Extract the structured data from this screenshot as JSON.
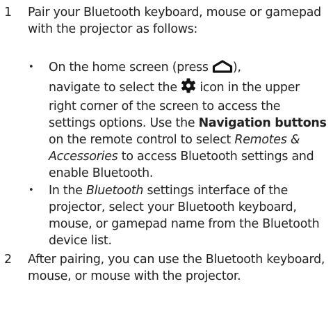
{
  "steps": [
    {
      "number": "1",
      "text": "Pair your Bluetooth keyboard, mouse or gamepad with the projector as follows:"
    },
    {
      "number": "2",
      "text": "After pairing, you can use the Bluetooth keyboard, mouse, or mouse with the projector."
    }
  ],
  "bullets": [
    {
      "marker": "•",
      "p1": "On the home screen (press ",
      "p2": "),",
      "p3": "navigate to select the ",
      "p4": " icon in the upper right corner of the screen to access the settings options. Use the ",
      "bold": "Navigation buttons",
      "p5": " on the remote control to select ",
      "italic": "Remotes & Accessories",
      "p6": " to access Bluetooth settings and enable Bluetooth."
    },
    {
      "marker": "•",
      "p1": "In the ",
      "italic": "Bluetooth",
      "p2": " settings interface of the projector, select your Bluetooth keyboard, mouse, or gamepad name from the Bluetooth device list."
    }
  ],
  "icons": {
    "home": "home-icon",
    "settings": "gear-icon"
  }
}
